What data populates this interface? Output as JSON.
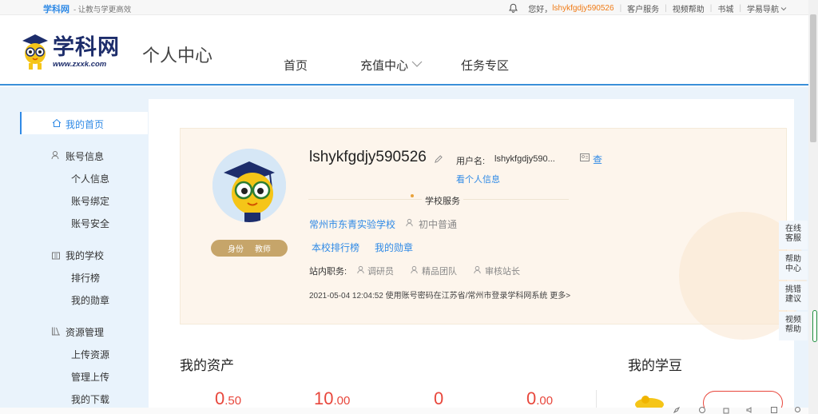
{
  "topbar": {
    "brand": "学科网",
    "slogan": "- 让教与学更高效",
    "greeting": "您好，",
    "username": "lshykfgdjy590526",
    "links": [
      "客户服务",
      "视频帮助",
      "书城",
      "学易导航"
    ]
  },
  "header": {
    "logo_text": "学科网",
    "logo_url": "www.zxxk.com",
    "page_title": "个人中心",
    "nav": [
      "首页",
      "充值中心",
      "任务专区"
    ]
  },
  "sidebar": {
    "home": "我的首页",
    "groups": [
      {
        "title": "账号信息",
        "items": [
          "个人信息",
          "账号绑定",
          "账号安全"
        ]
      },
      {
        "title": "我的学校",
        "items": [
          "排行榜",
          "我的勋章"
        ]
      },
      {
        "title": "资源管理",
        "items": [
          "上传资源",
          "管理上传",
          "我的下载"
        ]
      }
    ]
  },
  "profile": {
    "display_name": "lshykfgdjy590526",
    "username_label": "用户名:",
    "username_value": "lshykfgdjy590...",
    "view_label": "查",
    "view_info": "看个人信息",
    "school_service": "学校服务",
    "school": "常州市东青实验学校",
    "grade": "初中普通",
    "rank_link": "本校排行榜",
    "medal_link": "我的勋章",
    "duty_label": "站内职务:",
    "duties": [
      "调研员",
      "精品团队",
      "审核站长"
    ],
    "login_record": "2021-05-04 12:04:52 使用账号密码在江苏省/常州市登录学科网系统 更多>",
    "role_label": "身份",
    "role_value": "教师"
  },
  "assets": {
    "title": "我的资产",
    "values": [
      {
        "int": "0",
        "dec": ".50"
      },
      {
        "int": "10",
        "dec": ".00"
      },
      {
        "int": "0",
        "dec": ""
      },
      {
        "int": "0",
        "dec": ".00"
      }
    ],
    "beans_title": "我的学豆"
  },
  "float_panel": [
    "在线客服",
    "帮助中心",
    "挑错建议",
    "视频帮助"
  ],
  "colors": {
    "accent": "#2f8ae6",
    "orange": "#f07b16",
    "red": "#e8473c",
    "gold": "#c6a56a"
  }
}
